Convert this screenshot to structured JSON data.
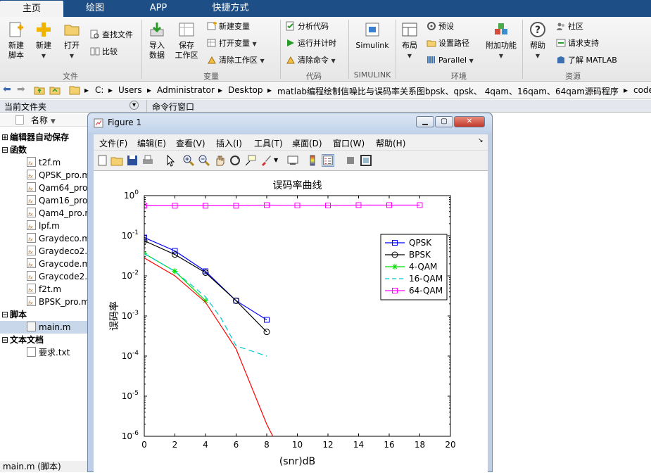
{
  "tabs": [
    {
      "label": "主页"
    },
    {
      "label": "绘图"
    },
    {
      "label": "APP"
    },
    {
      "label": "快捷方式"
    }
  ],
  "ribbon": {
    "new_script": "新建\n脚本",
    "new_script_l1": "新建",
    "new_script_l2": "脚本",
    "new": "新建",
    "open": "打开",
    "find_files": "查找文件",
    "compare": "比较",
    "import_l1": "导入",
    "import_l2": "数据",
    "workspace_l1": "保存",
    "workspace_l2": "工作区",
    "new_var": "新建变量",
    "open_var": "打开变量",
    "clear_ws": "清除工作区",
    "analyze": "分析代码",
    "run_time": "运行并计时",
    "clear_cmd": "清除命令",
    "simulink": "Simulink",
    "layout": "布局",
    "prefs": "预设",
    "set_path": "设置路径",
    "parallel": "Parallel",
    "addons": "附加功能",
    "help": "帮助",
    "community": "社区",
    "support": "请求支持",
    "learn": "了解 MATLAB",
    "sections": {
      "file": "文件",
      "variable": "变量",
      "code": "代码",
      "simulink": "SIMULINK",
      "env": "环境",
      "resources": "资源"
    }
  },
  "address": {
    "parts": [
      "C:",
      "Users",
      "Administrator",
      "Desktop",
      "matlab编程绘制信噪比与误码率关系图bpsk、qpsk、 4qam、16qam、64qam源码程序",
      "code"
    ]
  },
  "panes": {
    "current_folder": "当前文件夹",
    "command_window": "命令行窗口"
  },
  "tree": {
    "col_name": "名称",
    "groups": [
      {
        "label": "编辑器自动保存",
        "items": []
      },
      {
        "label": "函数",
        "items": [
          "t2f.m",
          "QPSK_pro.m",
          "Qam64_pro",
          "Qam16_pro",
          "Qam4_pro.m",
          "lpf.m",
          "Graydeco.m",
          "Graydeco2.",
          "Graycode.m",
          "Graycode2.",
          "f2t.m",
          "BPSK_pro.m"
        ]
      },
      {
        "label": "脚本",
        "items": [
          "main.m"
        ]
      },
      {
        "label": "文本文档",
        "items": [
          "要求.txt"
        ]
      }
    ]
  },
  "status": "main.m  (脚本)",
  "figure": {
    "title": "Figure 1",
    "menu": [
      "文件(F)",
      "编辑(E)",
      "查看(V)",
      "插入(I)",
      "工具(T)",
      "桌面(D)",
      "窗口(W)",
      "帮助(H)"
    ]
  },
  "chart_data": {
    "type": "line",
    "title": "误码率曲线",
    "xlabel": "(snr)dB",
    "ylabel": "误码率",
    "xlim": [
      0,
      20
    ],
    "ylim": [
      1e-06,
      1
    ],
    "yscale": "log",
    "x_ticks": [
      "0",
      "2",
      "4",
      "6",
      "8",
      "10",
      "12",
      "14",
      "16",
      "18",
      "20"
    ],
    "y_ticks": [
      "10-6",
      "10-5",
      "10-4",
      "10-3",
      "10-2",
      "10-1",
      "100"
    ],
    "legend": "top-right",
    "series": [
      {
        "name": "QPSK",
        "color": "#0000ff",
        "marker": "square",
        "x": [
          0,
          2,
          4,
          6,
          8
        ],
        "y": [
          0.09,
          0.042,
          0.013,
          0.0024,
          0.0008
        ]
      },
      {
        "name": "BPSK",
        "color": "#000000",
        "marker": "circle",
        "x": [
          0,
          2,
          4,
          6,
          8
        ],
        "y": [
          0.075,
          0.034,
          0.012,
          0.0024,
          0.0004
        ]
      },
      {
        "name": "4-QAM",
        "color": "#00dd00",
        "marker": "star",
        "x": [
          0,
          2,
          4
        ],
        "y": [
          0.036,
          0.013,
          0.0024
        ]
      },
      {
        "name": "16-QAM",
        "color": "#00cccc",
        "marker": "none",
        "dash": true,
        "x": [
          0,
          2,
          4,
          5,
          6,
          8
        ],
        "y": [
          0.036,
          0.013,
          0.003,
          0.0009,
          0.00018,
          0.0001
        ]
      },
      {
        "name": "64-QAM",
        "color": "#ff00ff",
        "marker": "square",
        "x": [
          0,
          2,
          4,
          6,
          8,
          10,
          12,
          14,
          16,
          18
        ],
        "y": [
          0.56,
          0.56,
          0.56,
          0.56,
          0.58,
          0.57,
          0.57,
          0.58,
          0.58,
          0.58
        ]
      },
      {
        "name": "",
        "color": "#ff0000",
        "marker": "none",
        "x": [
          0,
          2,
          4,
          6,
          8,
          8.4
        ],
        "y": [
          0.028,
          0.01,
          0.0022,
          0.00015,
          2e-06,
          1e-06
        ]
      }
    ]
  }
}
